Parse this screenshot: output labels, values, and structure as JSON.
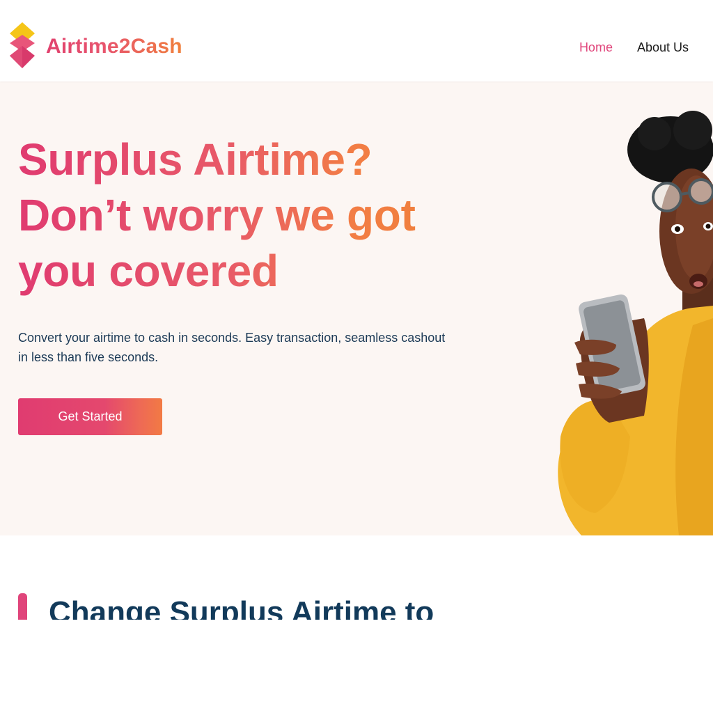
{
  "brand": {
    "name": "Airtime2Cash",
    "colors": {
      "pink": "#e0457b",
      "orange": "#f0803c",
      "yellow": "#f5c518",
      "navy": "#123a5a",
      "hero_background": "#fcf6f3"
    }
  },
  "nav": {
    "items": [
      {
        "label": "Home",
        "active": true
      },
      {
        "label": "About Us",
        "active": false
      }
    ]
  },
  "hero": {
    "title": "Surplus Airtime? Don’t worry we got you covered",
    "subtitle": "Convert your airtime to cash in seconds. Easy transaction, seamless cashout in less than five seconds.",
    "cta_label": "Get Started",
    "image": "surprised-man-holding-phone"
  },
  "section": {
    "title": "Change Surplus Airtime to"
  }
}
